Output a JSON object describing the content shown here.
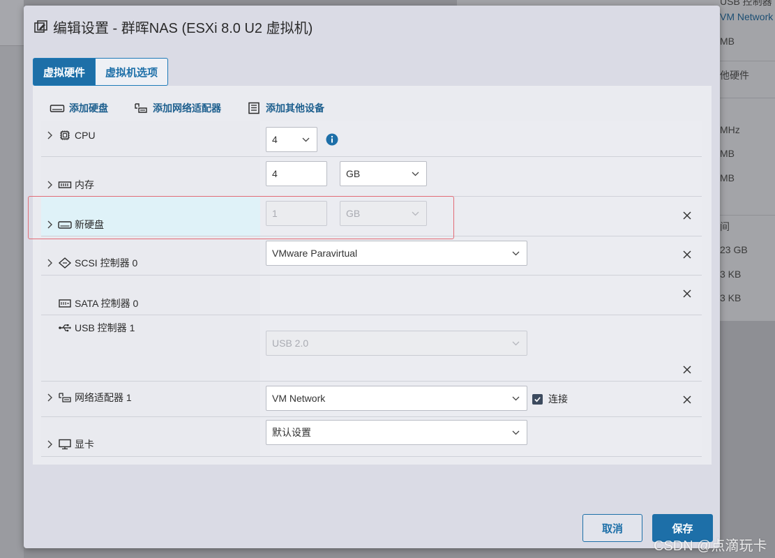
{
  "background": {
    "right_column": [
      "USB 控制器",
      "VM Network",
      "MB",
      "他硬件",
      "MHz",
      "MB",
      "MB",
      "间",
      "23 GB",
      "3 KB",
      "3 KB"
    ]
  },
  "dialog": {
    "title": "编辑设置 - 群晖NAS (ESXi 8.0 U2 虚拟机)"
  },
  "tabs": [
    {
      "label": "虚拟硬件",
      "active": true
    },
    {
      "label": "虚拟机选项",
      "active": false
    }
  ],
  "toolbar": {
    "add_disk": "添加硬盘",
    "add_network": "添加网络适配器",
    "add_other": "添加其他设备"
  },
  "rows": {
    "cpu": {
      "label": "CPU",
      "value": "4",
      "info_icon": "info-icon"
    },
    "memory": {
      "label": "内存",
      "value": "4",
      "unit": "GB"
    },
    "new_disk": {
      "label": "新硬盘",
      "value": "1",
      "unit": "GB"
    },
    "scsi": {
      "label": "SCSI 控制器 0",
      "value": "VMware Paravirtual"
    },
    "sata": {
      "label": "SATA 控制器 0"
    },
    "usb": {
      "label": "USB 控制器 1",
      "value": "USB 2.0"
    },
    "network": {
      "label": "网络适配器 1",
      "value": "VM Network",
      "connect_label": "连接",
      "connected": true
    },
    "display": {
      "label": "显卡",
      "value": "默认设置"
    }
  },
  "footer": {
    "cancel": "取消",
    "save": "保存"
  },
  "watermark": "CSDN @点滴玩卡",
  "colors": {
    "accent": "#1d6fa8",
    "highlight": "#e26b76",
    "selected_row": "#dff2f8"
  }
}
